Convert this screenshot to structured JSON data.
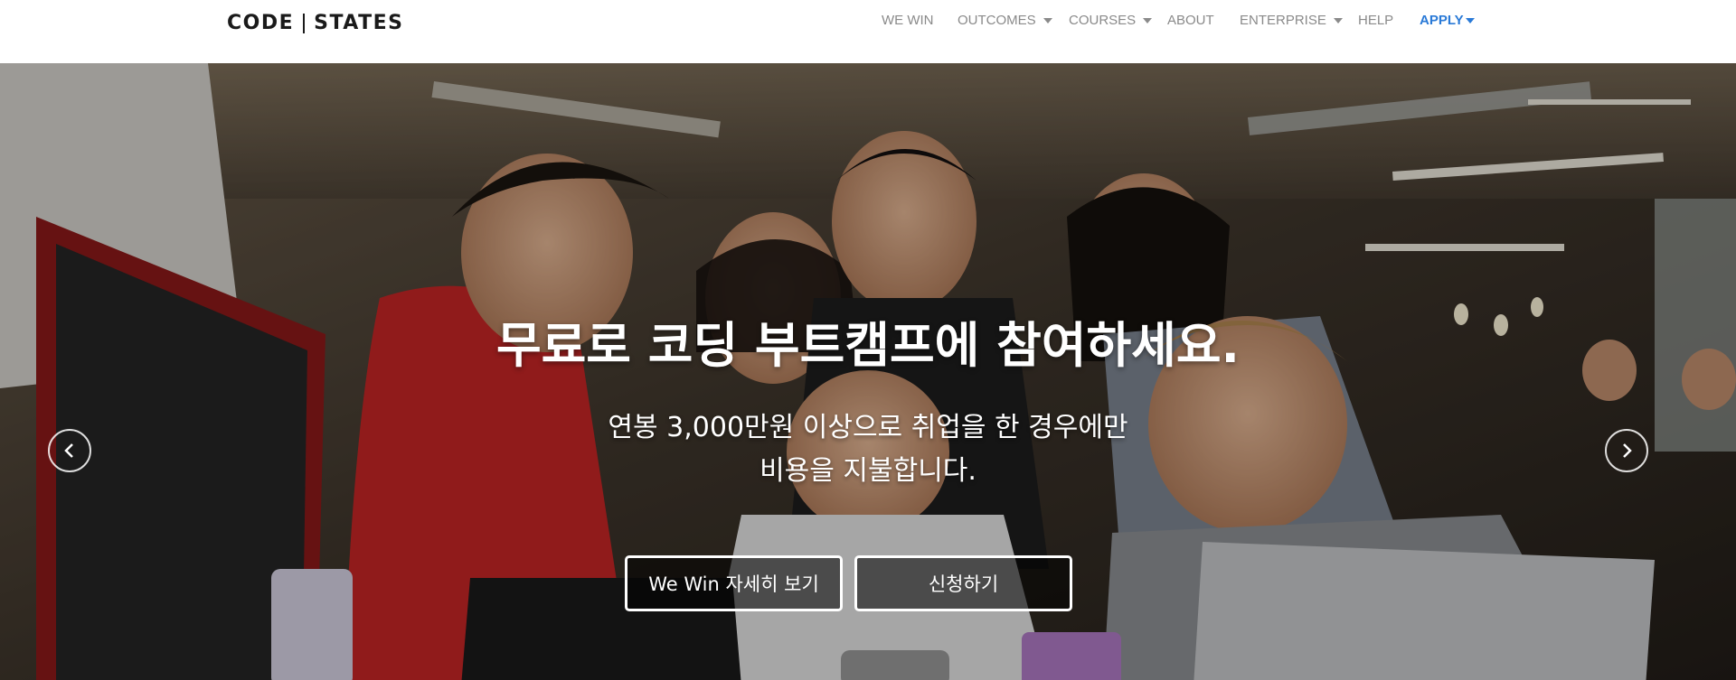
{
  "brand": {
    "logo_left": "CODE",
    "logo_right": "STATES"
  },
  "nav": {
    "items": [
      {
        "label": "WE WIN",
        "dropdown": false
      },
      {
        "label": "OUTCOMES",
        "dropdown": true
      },
      {
        "label": "COURSES",
        "dropdown": true
      },
      {
        "label": "ABOUT",
        "dropdown": false
      },
      {
        "label": "ENTERPRISE",
        "dropdown": true
      },
      {
        "label": "HELP",
        "dropdown": false
      },
      {
        "label": "APPLY",
        "dropdown": true
      }
    ]
  },
  "hero": {
    "title": "무료로 코딩 부트캠프에 참여하세요.",
    "subtitle_line1": "연봉 3,000만원 이상으로 취업을 한 경우에만",
    "subtitle_line2": "비용을 지불합니다.",
    "primary_button": "We Win 자세히 보기",
    "secondary_button": "신청하기",
    "prev_icon": "chevron-left-icon",
    "next_icon": "chevron-right-icon"
  },
  "colors": {
    "accent": "#2a7ad7",
    "nav_text": "#8a8a8a",
    "logo": "#1a1a1a"
  }
}
